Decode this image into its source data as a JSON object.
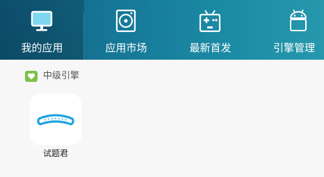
{
  "nav": {
    "items": [
      {
        "label": "我的应用",
        "icon": "monitor-icon",
        "active": true
      },
      {
        "label": "应用市场",
        "icon": "disc-icon",
        "active": false
      },
      {
        "label": "最新首发",
        "icon": "gamepad-icon",
        "active": false
      },
      {
        "label": "引擎管理",
        "icon": "android-icon",
        "active": false
      }
    ]
  },
  "section": {
    "title": "中级引擎",
    "icon": "heart-badge-icon",
    "accent": "#7dc14b"
  },
  "apps": [
    {
      "label": "试题君",
      "icon": "shitijun-app-icon",
      "color": "#1fa3e0"
    }
  ],
  "colors": {
    "topbar_start": "#0f5e83",
    "topbar_end": "#2698ad",
    "background": "#f7f7f7"
  }
}
